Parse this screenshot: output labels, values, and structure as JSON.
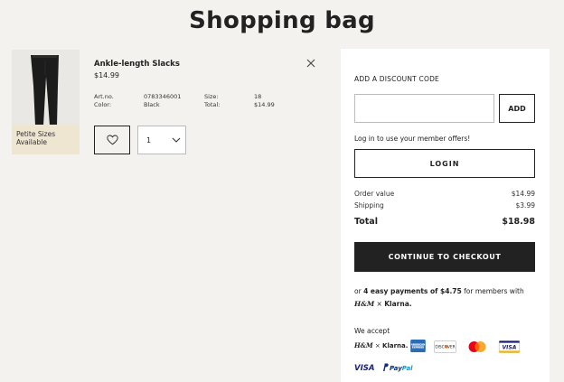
{
  "page": {
    "title": "Shopping bag"
  },
  "item": {
    "badge_line1": "Petite Sizes",
    "badge_line2": "Available",
    "name": "Ankle-length Slacks",
    "price": "$14.99",
    "artno_label": "Art.no.",
    "artno_value": "0783346001",
    "color_label": "Color:",
    "color_value": "Black",
    "size_label": "Size:",
    "size_value": "18",
    "total_label": "Total:",
    "total_value": "$14.99",
    "quantity": "1",
    "icons": {
      "remove": "close-icon",
      "favorite": "heart-icon",
      "quantity": "chevron-down-icon"
    }
  },
  "summary": {
    "discount_label": "ADD A DISCOUNT CODE",
    "discount_placeholder": "",
    "add_label": "ADD",
    "member_text": "Log in to use your member offers!",
    "login_label": "LOGIN",
    "order_value_label": "Order value",
    "order_value": "$14.99",
    "shipping_label": "Shipping",
    "shipping_value": "$3.99",
    "total_label": "Total",
    "total_value": "$18.98",
    "checkout_label": "CONTINUE TO CHECKOUT",
    "klarna_prefix": "or ",
    "klarna_bold": "4 easy payments of $4.75",
    "klarna_suffix": " for members with",
    "hm_logo": "H&M",
    "klarna_x": " × ",
    "klarna_logo": "Klarna.",
    "we_accept": "We accept",
    "payment_methods": {
      "hm_klarna": "H&M × Klarna.",
      "amex": "AMERICAN EXPRESS",
      "discover": "DISCOVER",
      "mastercard": "mastercard",
      "visa_card": "VISA",
      "visa": "VISA",
      "paypal": "PayPal"
    }
  },
  "colors": {
    "background": "#f4f2ef",
    "panel": "#ffffff",
    "checkout_button": "#222222",
    "petite_badge": "#efe6d2",
    "amex": "#2a6cb6",
    "visa": "#1a1f71",
    "paypal_dark": "#003087",
    "paypal_light": "#009cde",
    "mastercard_red": "#eb001b",
    "mastercard_yellow": "#f79e1b",
    "discover_orange": "#f47216"
  }
}
